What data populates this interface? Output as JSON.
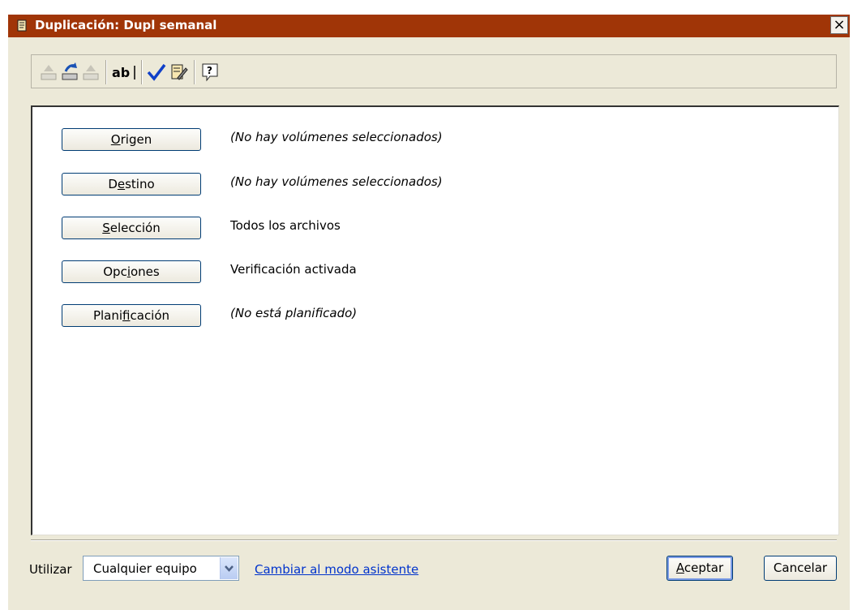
{
  "window": {
    "title": "Duplicación: Dupl semanal",
    "close_glyph": "×"
  },
  "toolbar": {
    "items": [
      {
        "name": "eject-disabled-icon",
        "enabled": false
      },
      {
        "name": "eject-icon",
        "enabled": true
      },
      {
        "name": "eject-alt-disabled-icon",
        "enabled": false
      },
      {
        "name": "rename-icon",
        "text": "ab|"
      },
      {
        "name": "checkmark-icon"
      },
      {
        "name": "edit-notes-icon"
      },
      {
        "name": "help-icon"
      }
    ]
  },
  "settings": [
    {
      "button_pre": "",
      "button_u": "O",
      "button_post": "rigen",
      "desc": "(No hay volúmenes seleccionados)",
      "italic": true
    },
    {
      "button_pre": "D",
      "button_u": "e",
      "button_post": "stino",
      "desc": "(No hay volúmenes seleccionados)",
      "italic": true
    },
    {
      "button_pre": "",
      "button_u": "S",
      "button_post": "elección",
      "desc": "Todos los archivos",
      "italic": false
    },
    {
      "button_pre": "Opc",
      "button_u": "i",
      "button_post": "ones",
      "desc": "Verificación activada",
      "italic": false
    },
    {
      "button_pre": "Plani",
      "button_u": "f",
      "button_post": "icación",
      "desc": "(No está planificado)",
      "italic": true
    }
  ],
  "footer": {
    "use_label": "Utilizar",
    "device_select": "Cualquier equipo",
    "wizard_link": "Cambiar al modo asistente",
    "accept_u": "A",
    "accept_rest": "ceptar",
    "cancel_label": "Cancelar"
  },
  "colors": {
    "titlebar": "#a03507",
    "link": "#0033cc"
  }
}
